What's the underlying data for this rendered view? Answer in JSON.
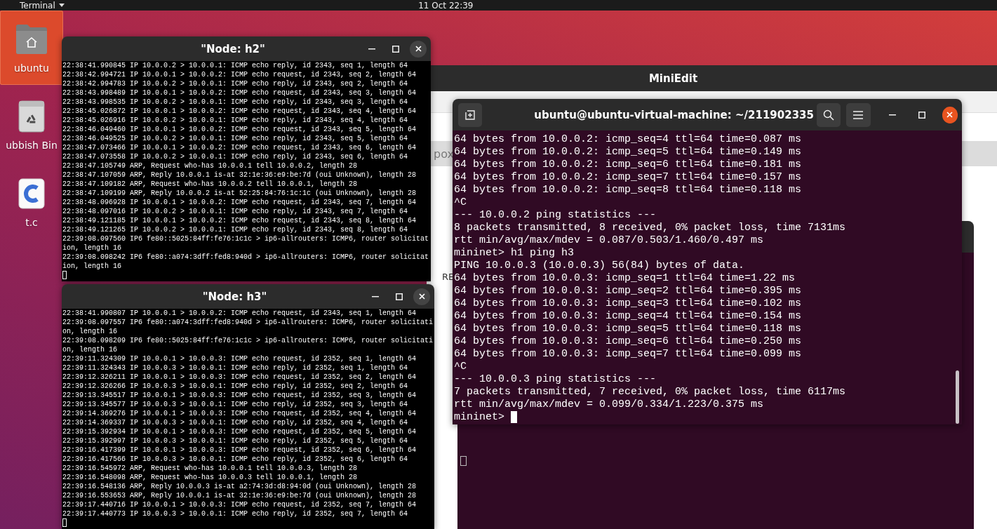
{
  "top_bar": {
    "app_menu": "Terminal",
    "clock": "11 Oct 22:39"
  },
  "desktop_icons": [
    {
      "label": "ubuntu",
      "kind": "home",
      "selected": true
    },
    {
      "label": "ubbish Bin",
      "kind": "trash",
      "selected": false
    },
    {
      "label": "t.c",
      "kind": "file",
      "selected": false
    }
  ],
  "background_app": {
    "title": "MiniEdit",
    "tab": "pox",
    "label": "RE"
  },
  "windows": [
    {
      "kind": "xterm",
      "title": "\"Node: h2\"",
      "focused": false,
      "lines": [
        "22:38:41.990845 IP 10.0.0.2 > 10.0.0.1: ICMP echo reply, id 2343, seq 1, length 64",
        "22:38:42.994721 IP 10.0.0.1 > 10.0.0.2: ICMP echo request, id 2343, seq 2, length 64",
        "22:38:42.994783 IP 10.0.0.2 > 10.0.0.1: ICMP echo reply, id 2343, seq 2, length 64",
        "22:38:43.998489 IP 10.0.0.1 > 10.0.0.2: ICMP echo request, id 2343, seq 3, length 64",
        "22:38:43.998535 IP 10.0.0.2 > 10.0.0.1: ICMP echo reply, id 2343, seq 3, length 64",
        "22:38:45.026872 IP 10.0.0.1 > 10.0.0.2: ICMP echo request, id 2343, seq 4, length 64",
        "22:38:45.026916 IP 10.0.0.2 > 10.0.0.1: ICMP echo reply, id 2343, seq 4, length 64",
        "22:38:46.049460 IP 10.0.0.1 > 10.0.0.2: ICMP echo request, id 2343, seq 5, length 64",
        "22:38:46.049525 IP 10.0.0.2 > 10.0.0.1: ICMP echo reply, id 2343, seq 5, length 64",
        "22:38:47.073466 IP 10.0.0.1 > 10.0.0.2: ICMP echo request, id 2343, seq 6, length 64",
        "22:38:47.073558 IP 10.0.0.2 > 10.0.0.1: ICMP echo reply, id 2343, seq 6, length 64",
        "22:38:47.105749 ARP, Request who-has 10.0.0.1 tell 10.0.0.2, length 28",
        "22:38:47.107059 ARP, Reply 10.0.0.1 is-at 32:1e:36:e9:be:7d (oui Unknown), length 28",
        "22:38:47.109182 ARP, Request who-has 10.0.0.2 tell 10.0.0.1, length 28",
        "22:38:47.109199 ARP, Reply 10.0.0.2 is-at 52:25:84:76:1c:1c (oui Unknown), length 28",
        "22:38:48.096928 IP 10.0.0.1 > 10.0.0.2: ICMP echo request, id 2343, seq 7, length 64",
        "22:38:48.097016 IP 10.0.0.2 > 10.0.0.1: ICMP echo reply, id 2343, seq 7, length 64",
        "22:38:49.121185 IP 10.0.0.1 > 10.0.0.2: ICMP echo request, id 2343, seq 8, length 64",
        "22:38:49.121265 IP 10.0.0.2 > 10.0.0.1: ICMP echo reply, id 2343, seq 8, length 64",
        "22:39:08.097560 IP6 fe80::5025:84ff:fe76:1c1c > ip6-allrouters: ICMP6, router solicitat",
        "ion, length 16",
        "22:39:08.098242 IP6 fe80::a074:3dff:fed8:940d > ip6-allrouters: ICMP6, router solicitat",
        "ion, length 16"
      ]
    },
    {
      "kind": "xterm",
      "title": "\"Node: h3\"",
      "focused": false,
      "lines": [
        "22:38:41.990807 IP 10.0.0.1 > 10.0.0.2: ICMP echo request, id 2343, seq 1, length 64",
        "22:39:08.097557 IP6 fe80::a074:3dff:fed8:940d > ip6-allrouters: ICMP6, router solicitati",
        "on, length 16",
        "22:39:08.098209 IP6 fe80::5025:84ff:fe76:1c1c > ip6-allrouters: ICMP6, router solicitati",
        "on, length 16",
        "22:39:11.324309 IP 10.0.0.1 > 10.0.0.3: ICMP echo request, id 2352, seq 1, length 64",
        "22:39:11.324343 IP 10.0.0.3 > 10.0.0.1: ICMP echo reply, id 2352, seq 1, length 64",
        "22:39:12.326211 IP 10.0.0.1 > 10.0.0.3: ICMP echo request, id 2352, seq 2, length 64",
        "22:39:12.326266 IP 10.0.0.3 > 10.0.0.1: ICMP echo reply, id 2352, seq 2, length 64",
        "22:39:13.345517 IP 10.0.0.1 > 10.0.0.3: ICMP echo request, id 2352, seq 3, length 64",
        "22:39:13.345577 IP 10.0.0.3 > 10.0.0.1: ICMP echo reply, id 2352, seq 3, length 64",
        "22:39:14.369276 IP 10.0.0.1 > 10.0.0.3: ICMP echo request, id 2352, seq 4, length 64",
        "22:39:14.369337 IP 10.0.0.3 > 10.0.0.1: ICMP echo reply, id 2352, seq 4, length 64",
        "22:39:15.392934 IP 10.0.0.1 > 10.0.0.3: ICMP echo request, id 2352, seq 5, length 64",
        "22:39:15.392997 IP 10.0.0.3 > 10.0.0.1: ICMP echo reply, id 2352, seq 5, length 64",
        "22:39:16.417399 IP 10.0.0.1 > 10.0.0.3: ICMP echo request, id 2352, seq 6, length 64",
        "22:39:16.417566 IP 10.0.0.3 > 10.0.0.1: ICMP echo reply, id 2352, seq 6, length 64",
        "22:39:16.545972 ARP, Request who-has 10.0.0.1 tell 10.0.0.3, length 28",
        "22:39:16.548098 ARP, Request who-has 10.0.0.3 tell 10.0.0.1, length 28",
        "22:39:16.548136 ARP, Reply 10.0.0.3 is-at a2:74:3d:d8:94:0d (oui Unknown), length 28",
        "22:39:16.553653 ARP, Reply 10.0.0.1 is-at 32:1e:36:e9:be:7d (oui Unknown), length 28",
        "22:39:17.440716 IP 10.0.0.1 > 10.0.0.3: ICMP echo request, id 2352, seq 7, length 64",
        "22:39:17.440773 IP 10.0.0.3 > 10.0.0.1: ICMP echo reply, id 2352, seq 7, length 64"
      ]
    },
    {
      "kind": "gnome",
      "title": "ubuntu@ubuntu-virtual-machine: ~/211902335",
      "focused": true,
      "lines": [
        "64 bytes from 10.0.0.2: icmp_seq=4 ttl=64 time=0.087 ms",
        "64 bytes from 10.0.0.2: icmp_seq=5 ttl=64 time=0.149 ms",
        "64 bytes from 10.0.0.2: icmp_seq=6 ttl=64 time=0.181 ms",
        "64 bytes from 10.0.0.2: icmp_seq=7 ttl=64 time=0.157 ms",
        "64 bytes from 10.0.0.2: icmp_seq=8 ttl=64 time=0.118 ms",
        "^C",
        "--- 10.0.0.2 ping statistics ---",
        "8 packets transmitted, 8 received, 0% packet loss, time 7131ms",
        "rtt min/avg/max/mdev = 0.087/0.503/1.460/0.497 ms",
        "mininet> h1 ping h3",
        "PING 10.0.0.3 (10.0.0.3) 56(84) bytes of data.",
        "64 bytes from 10.0.0.3: icmp_seq=1 ttl=64 time=1.22 ms",
        "64 bytes from 10.0.0.3: icmp_seq=2 ttl=64 time=0.395 ms",
        "64 bytes from 10.0.0.3: icmp_seq=3 ttl=64 time=0.102 ms",
        "64 bytes from 10.0.0.3: icmp_seq=4 ttl=64 time=0.154 ms",
        "64 bytes from 10.0.0.3: icmp_seq=5 ttl=64 time=0.118 ms",
        "64 bytes from 10.0.0.3: icmp_seq=6 ttl=64 time=0.250 ms",
        "64 bytes from 10.0.0.3: icmp_seq=7 ttl=64 time=0.099 ms",
        "^C",
        "--- 10.0.0.3 ping statistics ---",
        "7 packets transmitted, 7 received, 0% packet loss, time 6117ms",
        "rtt min/avg/max/mdev = 0.099/0.334/1.223/0.375 ms",
        "mininet>"
      ]
    }
  ]
}
